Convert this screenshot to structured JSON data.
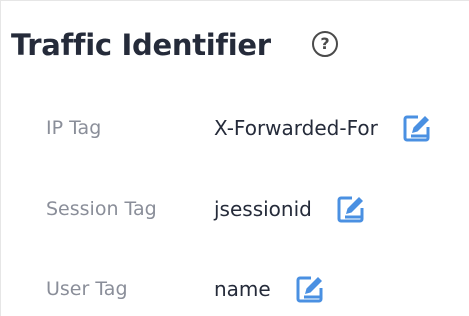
{
  "section": {
    "title": "Traffic Identifier",
    "help_icon": "question-circle-icon"
  },
  "fields": [
    {
      "label": "IP Tag",
      "value": "X-Forwarded-For",
      "icon": "edit-icon"
    },
    {
      "label": "Session Tag",
      "value": "jsessionid",
      "icon": "edit-icon"
    },
    {
      "label": "User Tag",
      "value": "name",
      "icon": "edit-icon"
    }
  ],
  "colors": {
    "title": "#252b3a",
    "label": "#8a8e99",
    "value": "#252b3a",
    "edit_icon": "#4a90e2"
  }
}
